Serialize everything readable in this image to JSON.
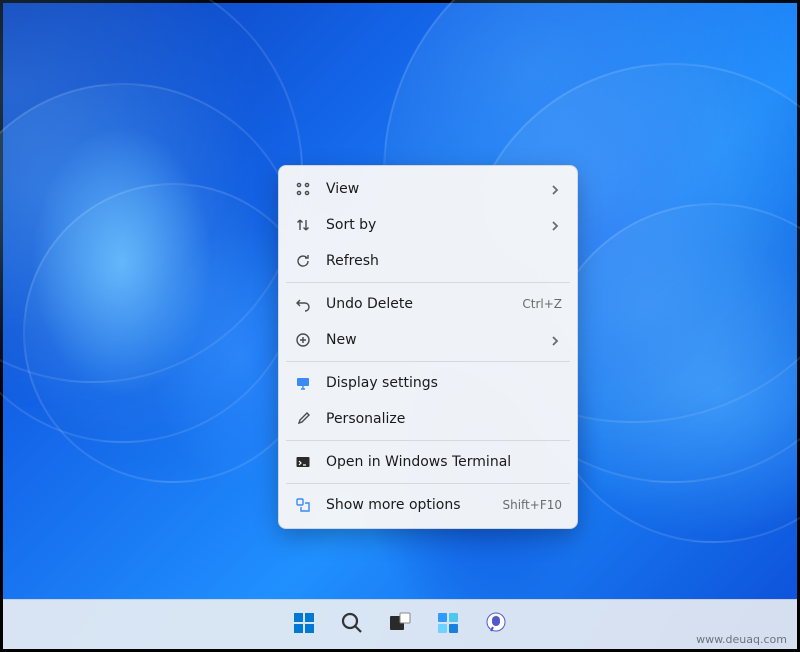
{
  "context_menu": {
    "groups": [
      [
        {
          "icon": "grid-icon",
          "label": "View",
          "submenu": true
        },
        {
          "icon": "sort-icon",
          "label": "Sort by",
          "submenu": true
        },
        {
          "icon": "refresh-icon",
          "label": "Refresh"
        }
      ],
      [
        {
          "icon": "undo-icon",
          "label": "Undo Delete",
          "shortcut": "Ctrl+Z"
        },
        {
          "icon": "plus-circle-icon",
          "label": "New",
          "submenu": true
        }
      ],
      [
        {
          "icon": "display-icon",
          "label": "Display settings"
        },
        {
          "icon": "paintbrush-icon",
          "label": "Personalize"
        }
      ],
      [
        {
          "icon": "terminal-icon",
          "label": "Open in Windows Terminal"
        }
      ],
      [
        {
          "icon": "more-options-icon",
          "label": "Show more options",
          "shortcut": "Shift+F10"
        }
      ]
    ]
  },
  "taskbar": {
    "items": [
      {
        "name": "start-button",
        "icon": "windows-icon"
      },
      {
        "name": "search-button",
        "icon": "search-icon"
      },
      {
        "name": "task-view-button",
        "icon": "taskview-icon"
      },
      {
        "name": "widgets-button",
        "icon": "widgets-icon"
      },
      {
        "name": "chat-button",
        "icon": "chat-icon"
      }
    ]
  },
  "watermark": "www.deuaq.com"
}
